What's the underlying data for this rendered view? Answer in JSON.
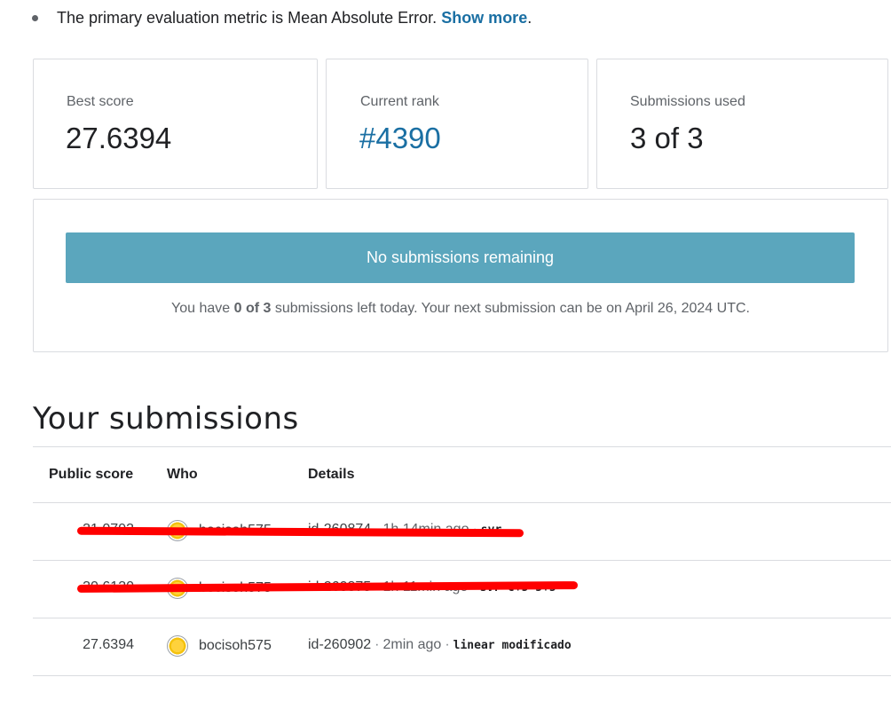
{
  "evaluation": {
    "text": "The primary evaluation metric is Mean Absolute Error.",
    "show_more": "Show more",
    "period": "."
  },
  "stats": {
    "best_score_label": "Best score",
    "best_score_value": "27.6394",
    "rank_label": "Current rank",
    "rank_value": "#4390",
    "submissions_label": "Submissions used",
    "submissions_value": "3 of 3"
  },
  "submit": {
    "button_label": "No submissions remaining",
    "text_prefix": "You have ",
    "text_bold": "0 of 3",
    "text_suffix": " submissions left today. Your next submission can be on April 26, 2024 UTC."
  },
  "submissions": {
    "title": "Your submissions",
    "columns": [
      "Public score",
      "Who",
      "Details"
    ],
    "rows": [
      {
        "score": "31.0793",
        "who": "bocisoh575",
        "id": "id-260874",
        "ago": "1h 14min ago",
        "desc": "svr"
      },
      {
        "score": "30.6130",
        "who": "bocisoh575",
        "id": "id-260875",
        "ago": "1h 11min ago",
        "desc": "svr c+5 5+5"
      },
      {
        "score": "27.6394",
        "who": "bocisoh575",
        "id": "id-260902",
        "ago": "2min ago",
        "desc": "linear modificado"
      }
    ]
  },
  "colors": {
    "accent": "#1a6fa3",
    "button": "#5ba6bd",
    "redaction": "#ff0000"
  }
}
